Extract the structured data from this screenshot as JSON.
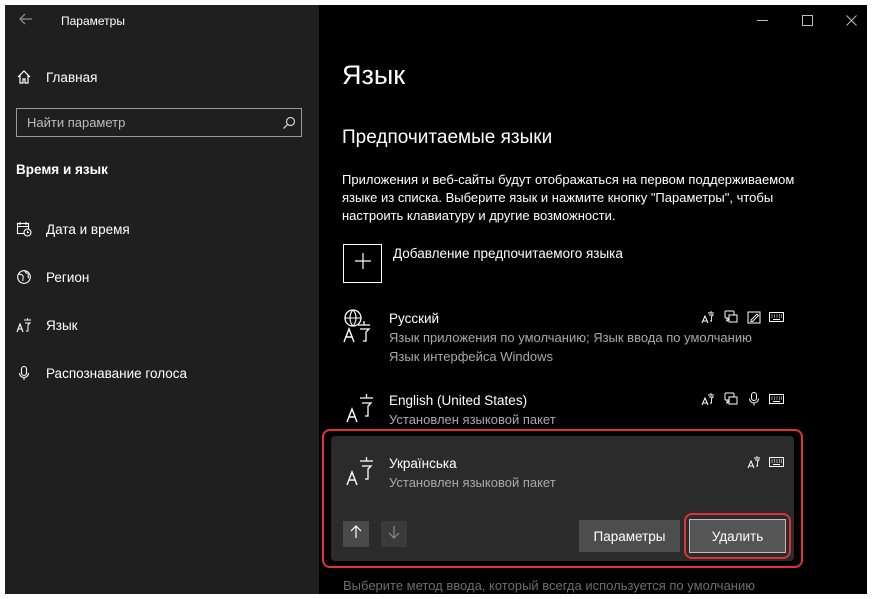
{
  "window": {
    "title": "Параметры",
    "controls": [
      "minimize-icon",
      "maximize-icon",
      "close-icon"
    ]
  },
  "sidebar": {
    "home_label": "Главная",
    "search_placeholder": "Найти параметр",
    "section_title": "Время и язык",
    "items": [
      {
        "label": "Дата и время",
        "icon": "calendar-clock-icon"
      },
      {
        "label": "Регион",
        "icon": "globe-icon"
      },
      {
        "label": "Язык",
        "icon": "language-icon"
      },
      {
        "label": "Распознавание голоса",
        "icon": "microphone-icon"
      }
    ]
  },
  "main": {
    "title": "Язык",
    "subtitle": "Предпочитаемые языки",
    "description": "Приложения и веб-сайты будут отображаться на первом поддерживаемом языке из списка. Выберите язык и нажмите кнопку \"Параметры\", чтобы настроить клавиатуру и другие возможности.",
    "add_language_label": "Добавление предпочитаемого языка",
    "languages": [
      {
        "name": "Русский",
        "line1": "Язык приложения по умолчанию; Язык ввода по умолчанию",
        "line2": "Язык интерфейса Windows",
        "features": [
          "display-language-icon",
          "speech-icon",
          "handwriting-icon",
          "keyboard-icon"
        ]
      },
      {
        "name": "English (United States)",
        "line1": "Установлен языковой пакет",
        "features": [
          "display-language-icon",
          "speech-icon",
          "microphone-icon",
          "keyboard-icon"
        ]
      },
      {
        "name": "Українська",
        "line1": "Установлен языковой пакет",
        "features": [
          "display-language-icon",
          "keyboard-icon"
        ]
      }
    ],
    "options_button": "Параметры",
    "remove_button": "Удалить",
    "bottom_hint": "Выберите метод ввода, который всегда используется по умолчанию"
  },
  "colors": {
    "highlight_outline": "#e0303a",
    "sidebar_bg": "#1f1f1f",
    "main_bg": "#000000",
    "selected_bg": "#2b2b2b"
  }
}
